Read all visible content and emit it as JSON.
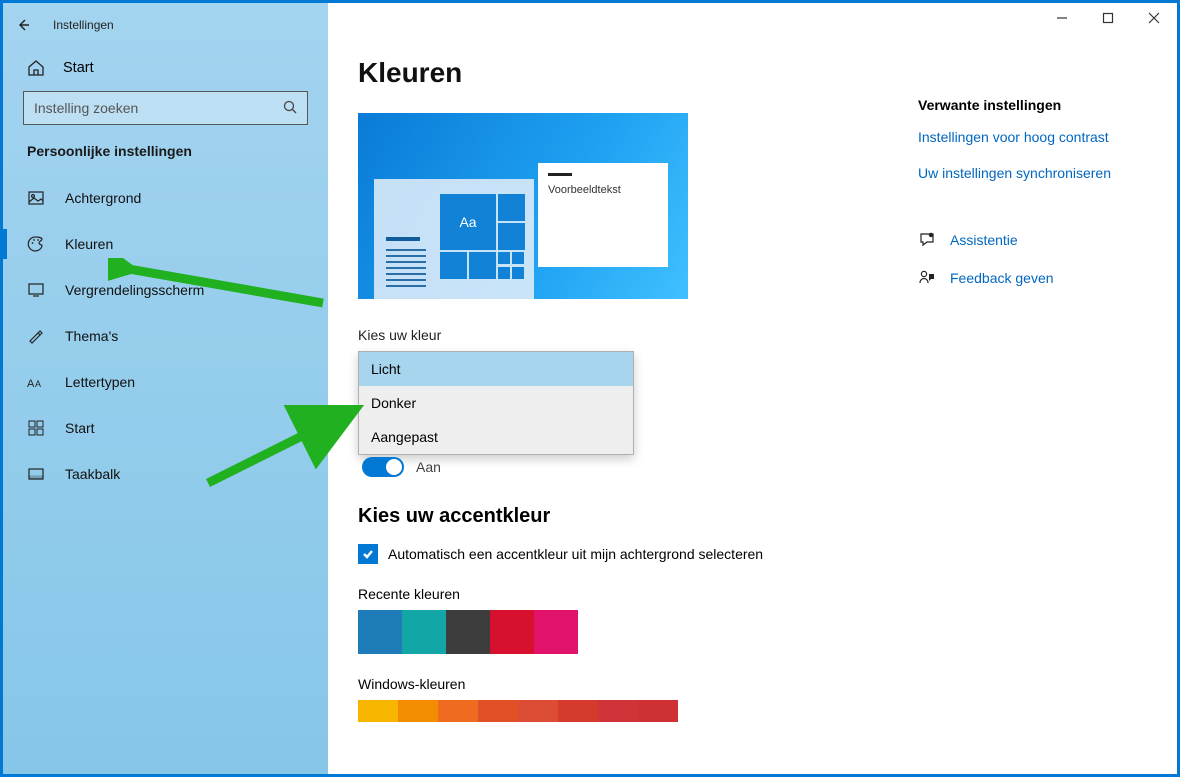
{
  "window": {
    "title": "Instellingen"
  },
  "sidebar": {
    "home": "Start",
    "search_placeholder": "Instelling zoeken",
    "section": "Persoonlijke instellingen",
    "items": [
      {
        "label": "Achtergrond"
      },
      {
        "label": "Kleuren"
      },
      {
        "label": "Vergrendelingsscherm"
      },
      {
        "label": "Thema's"
      },
      {
        "label": "Lettertypen"
      },
      {
        "label": "Start"
      },
      {
        "label": "Taakbalk"
      }
    ]
  },
  "page": {
    "title": "Kleuren",
    "preview_sample_text": "Voorbeeldtekst",
    "preview_tile_text": "Aa",
    "choose_color_label": "Kies uw kleur",
    "color_options": [
      "Licht",
      "Donker",
      "Aangepast"
    ],
    "color_selected": "Licht",
    "toggle_label": "Aan",
    "accent_heading": "Kies uw accentkleur",
    "auto_accent_checkbox": "Automatisch een accentkleur uit mijn achtergrond selecteren",
    "recent_label": "Recente kleuren",
    "recent_colors": [
      "#1e7cb8",
      "#12a6a6",
      "#3d3d3d",
      "#d81030",
      "#e0126a"
    ],
    "windows_colors_label": "Windows-kleuren",
    "windows_colors": [
      "#f7b500",
      "#f28c00",
      "#ee6b1f",
      "#e25028",
      "#dd4c34",
      "#d63a2d",
      "#d13438",
      "#cf3033"
    ]
  },
  "related": {
    "heading": "Verwante instellingen",
    "links": [
      "Instellingen voor hoog contrast",
      "Uw instellingen synchroniseren"
    ],
    "help": [
      {
        "icon": "chat",
        "label": "Assistentie"
      },
      {
        "icon": "feedback",
        "label": "Feedback geven"
      }
    ]
  }
}
